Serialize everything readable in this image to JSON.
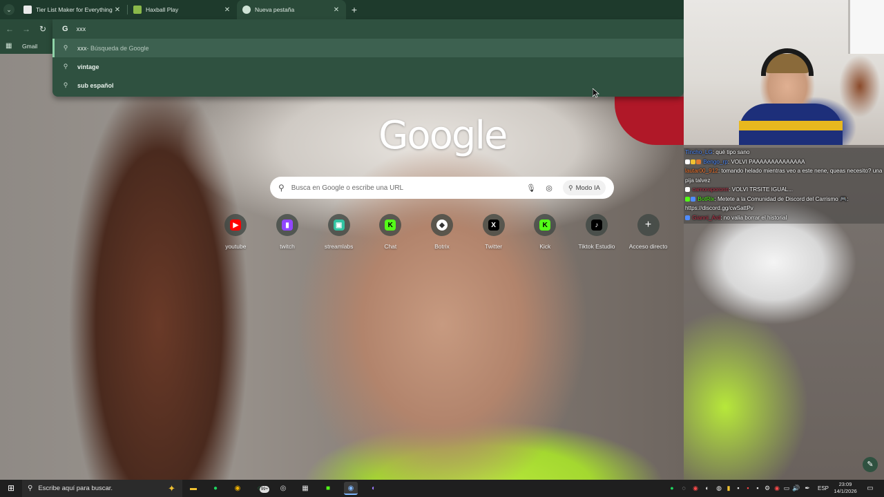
{
  "tabs": [
    {
      "title": "Tier List Maker for Everything -",
      "favicon_color": "#e9e9e9",
      "active": false
    },
    {
      "title": "Haxball Play",
      "favicon_color": "#8bb94a",
      "active": false
    },
    {
      "title": "Nueva pestaña",
      "favicon_color": "#cfe3d6",
      "active": true
    }
  ],
  "tab_close_glyph": "✕",
  "new_tab_glyph": "+",
  "omnibox": {
    "engine_glyph": "G",
    "input_value": "xxx",
    "suggestions": [
      {
        "prefix": "xxx",
        "suffix": " - Búsqueda de Google",
        "selected": true
      },
      {
        "prefix": "",
        "suffix": "vintage",
        "selected": false
      },
      {
        "prefix": "",
        "suffix": "sub español",
        "selected": false
      }
    ]
  },
  "bookmarks": {
    "item": "Gmail"
  },
  "ntp": {
    "logo": "Google",
    "search_placeholder": "Busca en Google o escribe una URL",
    "ai_mode_label": "Modo IA",
    "shortcuts": [
      {
        "label": "youtube",
        "glyph": "▶",
        "color": "#ff0000",
        "icon": "youtube-icon"
      },
      {
        "label": "twitch",
        "glyph": "▮",
        "color": "#9146ff",
        "icon": "twitch-icon"
      },
      {
        "label": "streamlabs",
        "glyph": "▣",
        "color": "#31c3a2",
        "icon": "streamlabs-icon"
      },
      {
        "label": "Chat",
        "glyph": "K",
        "color": "#53fc18",
        "icon": "kick-icon"
      },
      {
        "label": "Botrix",
        "glyph": "◆",
        "color": "#ffffff",
        "icon": "botrix-icon"
      },
      {
        "label": "Twitter",
        "glyph": "X",
        "color": "#000000",
        "icon": "x-icon"
      },
      {
        "label": "Kick",
        "glyph": "K",
        "color": "#53fc18",
        "icon": "kick-icon"
      },
      {
        "label": "Tiktok Estudio",
        "glyph": "♪",
        "color": "#000000",
        "icon": "tiktok-icon"
      },
      {
        "label": "Acceso directo",
        "glyph": "+",
        "color": "transparent",
        "icon": "add-shortcut-icon"
      }
    ]
  },
  "chat": [
    {
      "user": "Tincho_LG",
      "user_color": "#4f8cff",
      "message": ": qué tipo sano"
    },
    {
      "user": "Bengo_rp",
      "user_color": "#4f8cff",
      "message": ": VOLVI PAAAAAAAAAAAAAA"
    },
    {
      "user": "lautar00_912",
      "user_color": "#ff7a2f",
      "message": ": tomando helado mientras veo a este nene, queas necesito? una pija talvez"
    },
    {
      "user": "camoraporonn",
      "user_color": "#c0334a",
      "message": ": VOLVI TRSITE IGUAL..."
    },
    {
      "user": "BotRix",
      "user_color": "#53fc18",
      "message": ": Metete a la Comunidad de Discord del Carrismo 🎮: https://discord.gg/cwSattPv"
    },
    {
      "user": "Gianni_Ard",
      "user_color": "#c0334a",
      "message": ": no valia borrar el historial"
    }
  ],
  "taskbar": {
    "search_placeholder": "Escribe aquí para buscar.",
    "badge_count": "99+",
    "language": "ESP",
    "time": "23:09",
    "date": "14/1/2026"
  }
}
